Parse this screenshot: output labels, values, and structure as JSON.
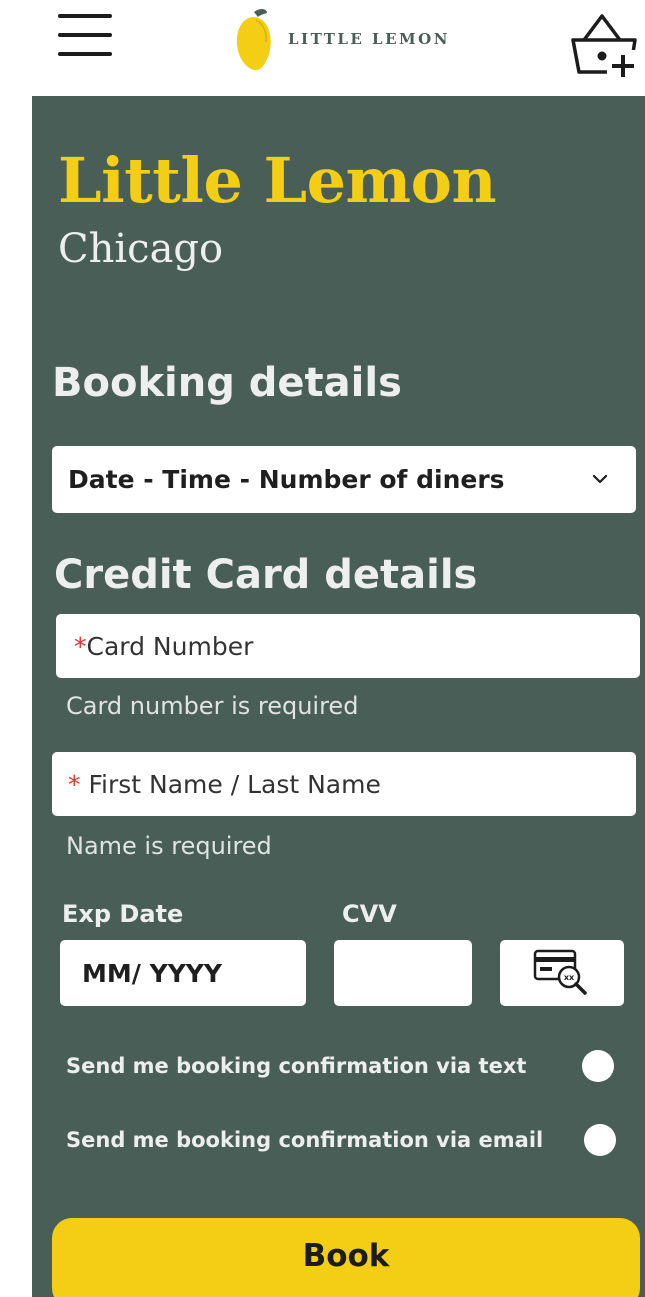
{
  "header": {
    "logo_text": "LITTLE LEMON"
  },
  "brand": {
    "title": "Little Lemon",
    "subtitle": "Chicago"
  },
  "booking": {
    "heading": "Booking details",
    "select_value": "Date - Time - Number of diners"
  },
  "credit_card": {
    "heading": "Credit Card details",
    "card_number": {
      "required_mark": "*",
      "placeholder": "Card Number",
      "error": "Card number is required"
    },
    "name": {
      "required_mark": "* ",
      "placeholder": "First Name / Last Name",
      "error": "Name is required"
    },
    "exp_date": {
      "label": "Exp Date",
      "placeholder": "MM/ YYYY"
    },
    "cvv": {
      "label": "CVV",
      "value": ""
    }
  },
  "confirmations": [
    {
      "label": "Send me booking confirmation via text"
    },
    {
      "label": "Send me booking confirmation via email"
    }
  ],
  "book_button": "Book",
  "colors": {
    "primary_green": "#495e57",
    "primary_yellow": "#f4ce14",
    "required_red": "#d9362f"
  },
  "icons": {
    "menu": "hamburger-menu-icon",
    "logo": "lemon-icon",
    "basket": "basket-add-icon",
    "cvv_help": "card-magnifier-icon",
    "select": "chevron-down-icon"
  }
}
